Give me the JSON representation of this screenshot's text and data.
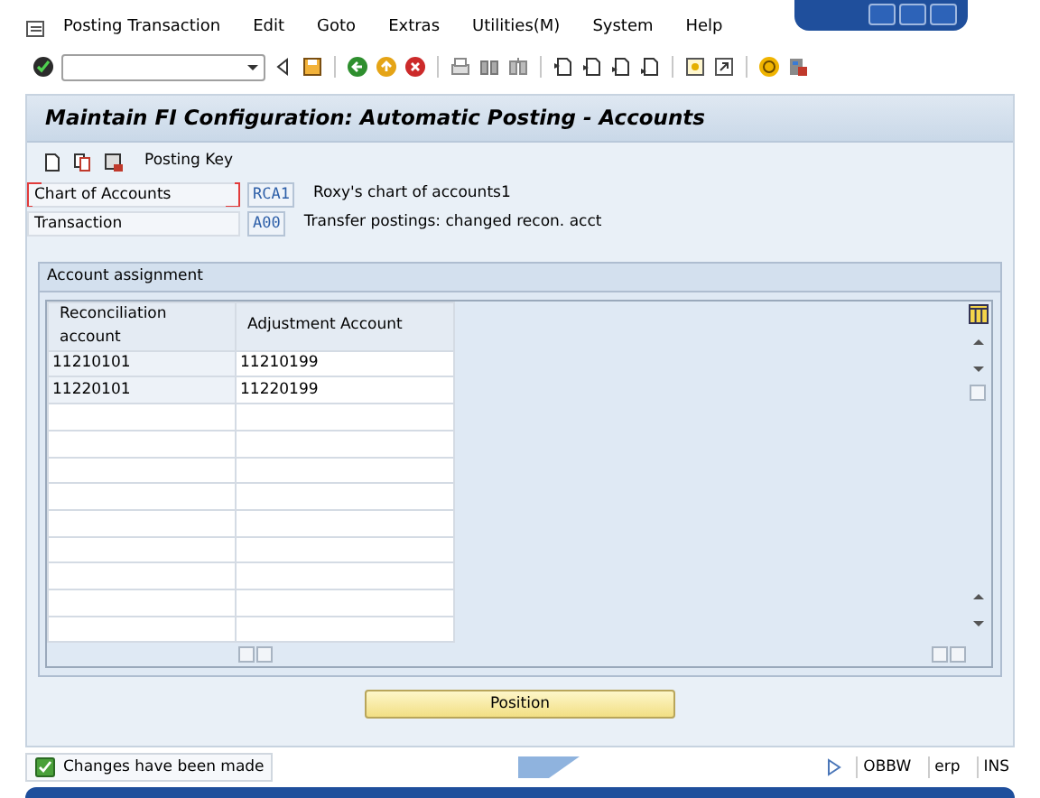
{
  "menu": [
    {
      "label": "Posting Transaction"
    },
    {
      "label": "Edit"
    },
    {
      "label": "Goto"
    },
    {
      "label": "Extras"
    },
    {
      "label": "Utilities(M)"
    },
    {
      "label": "System"
    },
    {
      "label": "Help"
    }
  ],
  "title": "Maintain FI Configuration: Automatic Posting - Accounts",
  "app_toolbar": {
    "button": "Posting Key"
  },
  "fields": [
    {
      "label": "Chart of Accounts",
      "value": "RCA1",
      "description": "Roxy's chart of accounts1",
      "focused": true
    },
    {
      "label": "Transaction",
      "value": "A00",
      "description": "Transfer postings: changed recon. acct",
      "focused": false
    }
  ],
  "group": {
    "title": "Account assignment",
    "columns": [
      "Reconciliation account",
      "Adjustment Account"
    ],
    "rows": [
      [
        "11210101",
        "11210199"
      ],
      [
        "11220101",
        "11220199"
      ]
    ]
  },
  "position_button": "Position",
  "status_bar": {
    "message": "Changes have been made",
    "system": "OBBW",
    "client": "erp",
    "mode": "INS"
  }
}
